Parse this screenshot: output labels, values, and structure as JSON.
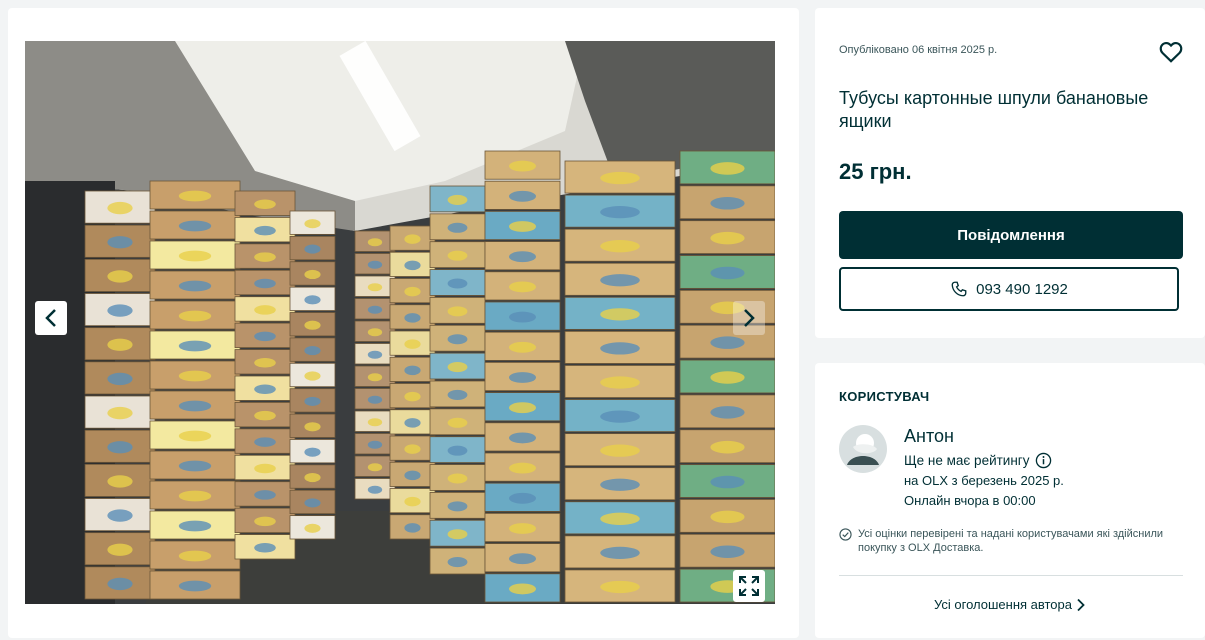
{
  "listing": {
    "published": "Опубліковано 06 квітня 2025 р.",
    "title": "Тубусы картонные шпули банановые ящики",
    "price": "25 грн.",
    "message_label": "Повідомлення",
    "phone": "093 490 1292",
    "icons": {
      "favorite": "heart-icon",
      "phone": "phone-icon"
    }
  },
  "gallery": {
    "icons": {
      "prev": "chevron-left-icon",
      "next": "chevron-right-icon",
      "fullscreen": "expand-icon"
    },
    "photo_subject": "warehouse-with-banana-boxes"
  },
  "user": {
    "heading": "КОРИСТУВАЧ",
    "name": "Антон",
    "rating": "Ще не має рейтингу",
    "since": "на OLX з березень 2025 р.",
    "online": "Онлайн вчора в 00:00",
    "verified_note": "Усі оцінки перевірені та надані користувачами які здійснили покупку з OLX Доставка.",
    "all_ads": "Усі оголошення автора"
  },
  "colors": {
    "brand_dark": "#002f34",
    "page_bg": "#f2f4f5",
    "card_bg": "#ffffff"
  }
}
